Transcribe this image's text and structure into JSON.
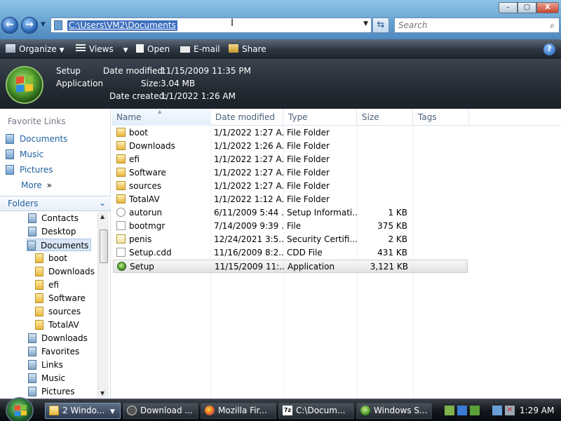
{
  "window": {
    "min_label": "–",
    "max_label": "▢",
    "close_label": "X"
  },
  "address": {
    "path": "C:\\Users\\VM2\\Documents",
    "search_placeholder": "Search"
  },
  "toolbar": {
    "organize": "Organize",
    "views": "Views",
    "open": "Open",
    "email": "E-mail",
    "share": "Share",
    "help": "?"
  },
  "details": {
    "name": "Setup",
    "type": "Application",
    "date_modified_label": "Date modified:",
    "date_modified": "11/15/2009 11:35 PM",
    "size_label": "Size:",
    "size": "3.04 MB",
    "date_created_label": "Date created:",
    "date_created": "1/1/2022 1:26 AM"
  },
  "nav": {
    "favorite_links_header": "Favorite Links",
    "favorites": [
      "Documents",
      "Music",
      "Pictures"
    ],
    "more": "More",
    "more_chev": "»",
    "folders": "Folders",
    "folders_chev": "⌄",
    "tree": [
      {
        "label": "Contacts",
        "icon": "library"
      },
      {
        "label": "Desktop",
        "icon": "library"
      },
      {
        "label": "Documents",
        "icon": "library",
        "selected": true
      },
      {
        "label": "boot",
        "icon": "folder"
      },
      {
        "label": "Downloads",
        "icon": "folder"
      },
      {
        "label": "efi",
        "icon": "folder"
      },
      {
        "label": "Software",
        "icon": "folder"
      },
      {
        "label": "sources",
        "icon": "folder"
      },
      {
        "label": "TotalAV",
        "icon": "folder"
      },
      {
        "label": "Downloads",
        "icon": "library"
      },
      {
        "label": "Favorites",
        "icon": "library"
      },
      {
        "label": "Links",
        "icon": "library"
      },
      {
        "label": "Music",
        "icon": "library"
      },
      {
        "label": "Pictures",
        "icon": "library"
      }
    ]
  },
  "columns": {
    "name": "Name",
    "date": "Date modified",
    "type": "Type",
    "size": "Size",
    "tags": "Tags"
  },
  "files": [
    {
      "name": "boot",
      "date": "1/1/2022 1:27 A...",
      "type": "File Folder",
      "size": "",
      "icon": "folder"
    },
    {
      "name": "Downloads",
      "date": "1/1/2022 1:26 A...",
      "type": "File Folder",
      "size": "",
      "icon": "folder"
    },
    {
      "name": "efi",
      "date": "1/1/2022 1:27 A...",
      "type": "File Folder",
      "size": "",
      "icon": "folder"
    },
    {
      "name": "Software",
      "date": "1/1/2022 1:27 A...",
      "type": "File Folder",
      "size": "",
      "icon": "folder"
    },
    {
      "name": "sources",
      "date": "1/1/2022 1:27 A...",
      "type": "File Folder",
      "size": "",
      "icon": "folder"
    },
    {
      "name": "TotalAV",
      "date": "1/1/2022 1:12 A...",
      "type": "File Folder",
      "size": "",
      "icon": "folder"
    },
    {
      "name": "autorun",
      "date": "6/11/2009 5:44 ...",
      "type": "Setup Informati...",
      "size": "1 KB",
      "icon": "setupinfo"
    },
    {
      "name": "bootmgr",
      "date": "7/14/2009 9:39 ...",
      "type": "File",
      "size": "375 KB",
      "icon": "file"
    },
    {
      "name": "penis",
      "date": "12/24/2021 3:5...",
      "type": "Security Certifi...",
      "size": "2 KB",
      "icon": "cert"
    },
    {
      "name": "Setup.cdd",
      "date": "11/16/2009 8:2...",
      "type": "CDD File",
      "size": "431 KB",
      "icon": "file"
    },
    {
      "name": "Setup",
      "date": "11/15/2009 11:...",
      "type": "Application",
      "size": "3,121 KB",
      "icon": "app",
      "selected": true
    }
  ],
  "taskbar": {
    "buttons": [
      {
        "label": "2 Windo...",
        "active": true
      },
      {
        "label": "Download ..."
      },
      {
        "label": "Mozilla Fir..."
      },
      {
        "label": "C:\\Docum..."
      },
      {
        "label": "Windows S..."
      }
    ],
    "clock": "1:29 AM"
  }
}
